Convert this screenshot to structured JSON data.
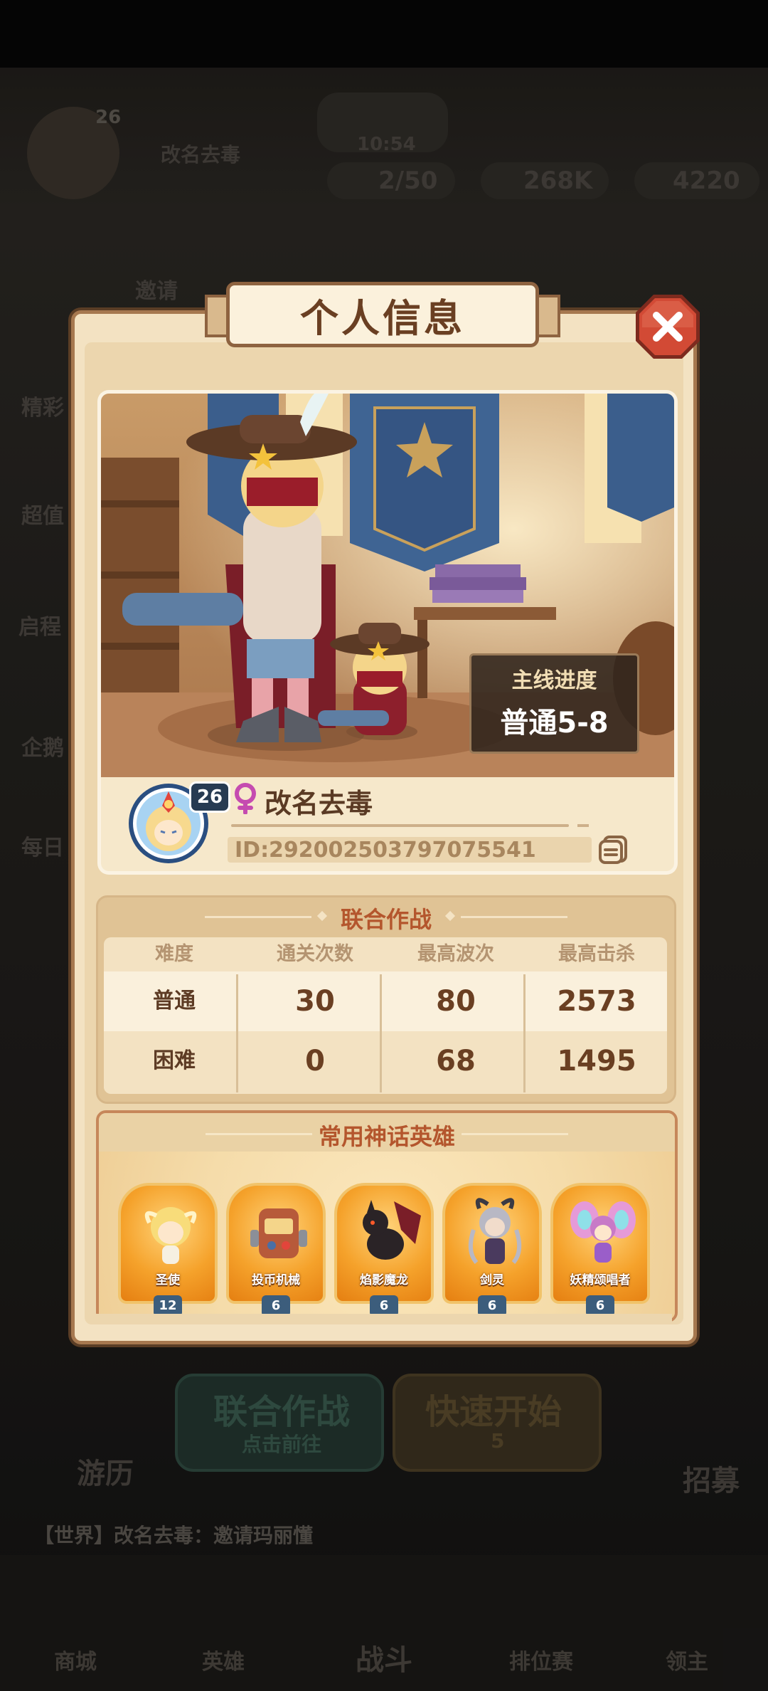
{
  "background": {
    "player_name": "改名去毒",
    "player_level": "26",
    "energy": "10:54",
    "stamina": "2/50",
    "gold": "268K",
    "gems": "4220",
    "left_menu": [
      "邀请",
      "精彩",
      "超值",
      "启程",
      "企鹅",
      "每日"
    ],
    "buttons": [
      {
        "title": "联合作战",
        "subtitle": "点击前往"
      },
      {
        "title": "快速开始",
        "subtitle": "5"
      }
    ],
    "side_labels": [
      "游历",
      "招募"
    ],
    "chat": "【世界】改名去毒：邀请玛丽懂",
    "nav": [
      "商城",
      "英雄",
      "战斗",
      "排位赛",
      "领主"
    ]
  },
  "dialog": {
    "title": "个人信息",
    "close_icon": "close-icon",
    "main_progress_label": "主线进度",
    "main_progress_value": "普通5-8",
    "player": {
      "name": "改名去毒",
      "level": "26",
      "id": "ID:292002503797075541",
      "gender": "female"
    },
    "joint_battle": {
      "title": "联合作战",
      "headers": [
        "难度",
        "通关次数",
        "最高波次",
        "最高击杀"
      ],
      "rows": [
        [
          "普通",
          "30",
          "80",
          "2573"
        ],
        [
          "困难",
          "0",
          "68",
          "1495"
        ]
      ]
    },
    "heroes": {
      "title": "常用神话英雄",
      "list": [
        {
          "name": "圣使",
          "level": "12"
        },
        {
          "name": "投币机械",
          "level": "6"
        },
        {
          "name": "焰影魔龙",
          "level": "6"
        },
        {
          "name": "剑灵",
          "level": "6"
        },
        {
          "name": "妖精颂唱者",
          "level": "6"
        }
      ]
    }
  },
  "colors": {
    "dialog_bg": "#f3e2c2",
    "title_text": "#6a3f22",
    "section_title": "#b4562d",
    "close_red": "#c2392b"
  }
}
